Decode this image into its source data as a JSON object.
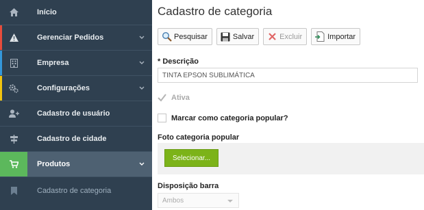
{
  "sidebar": {
    "items": [
      {
        "label": "Início",
        "icon": "home-icon"
      },
      {
        "label": "Gerenciar Pedidos",
        "icon": "warning-icon"
      },
      {
        "label": "Empresa",
        "icon": "building-icon"
      },
      {
        "label": "Configurações",
        "icon": "gears-icon"
      },
      {
        "label": "Cadastro de usuário",
        "icon": "user-add-icon"
      },
      {
        "label": "Cadastro de cidade",
        "icon": "signpost-icon"
      },
      {
        "label": "Produtos",
        "icon": "cart-icon"
      }
    ],
    "sub_item": {
      "label": "Cadastro de categoria",
      "icon": "bookmark-icon"
    }
  },
  "main": {
    "title": "Cadastro de categoria",
    "toolbar": {
      "search": "Pesquisar",
      "save": "Salvar",
      "delete": "Excluir",
      "import": "Importar"
    },
    "descricao_label": "* Descrição",
    "descricao_value": "TINTA EPSON SUBLIMÁTICA",
    "ativa_label": "Ativa",
    "popular_label": "Marcar como categoria popular?",
    "foto_label": "Foto categoria popular",
    "selecionar_button": "Selecionar...",
    "disposicao_label": "Disposição barra",
    "disposicao_value": "Ambos"
  },
  "colors": {
    "sidebar_bg": "#2f4050",
    "active_item_bg": "#4e6172",
    "active_icon_bg": "#5cb85c",
    "select_button": "#7cb319"
  }
}
